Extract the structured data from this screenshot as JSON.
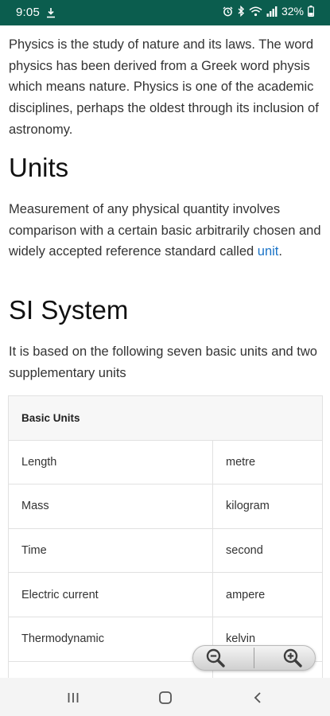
{
  "status_bar": {
    "time": "9:05",
    "battery": "32%",
    "icons": [
      "download-icon",
      "alarm-icon",
      "bluetooth-icon",
      "wifi-icon",
      "signal-icon",
      "battery-icon"
    ]
  },
  "article": {
    "intro": "Physics is the study of nature and its laws. The word physics has been derived from a Greek word physis which means nature. Physics is one of the academic disciplines, perhaps the oldest through its inclusion of astronomy.",
    "units_heading": "Units",
    "units_text": "Measurement of any physical quantity involves comparison with a certain basic arbitrarily chosen and widely accepted reference standard called",
    "units_link": "unit",
    "units_period": ".",
    "si_heading": "SI System",
    "si_text": "It is based on the following seven basic units and two supplementary units"
  },
  "table": {
    "header": "Basic Units",
    "rows": [
      {
        "quantity": "Length",
        "unit": "metre"
      },
      {
        "quantity": "Mass",
        "unit": "kilogram"
      },
      {
        "quantity": "Time",
        "unit": "second"
      },
      {
        "quantity": "Electric current",
        "unit": "ampere"
      },
      {
        "quantity": "Thermodynamic",
        "unit": "kelvin"
      }
    ]
  },
  "zoom": {
    "out_icon": "zoom-out-icon",
    "in_icon": "zoom-in-icon"
  },
  "nav_bar": {
    "icons": [
      "recent-apps-icon",
      "home-icon",
      "back-icon"
    ]
  },
  "colors": {
    "status_bar": "#0b5d4e",
    "link": "#1a73c7",
    "table_header_bg": "#f7f7f7"
  }
}
